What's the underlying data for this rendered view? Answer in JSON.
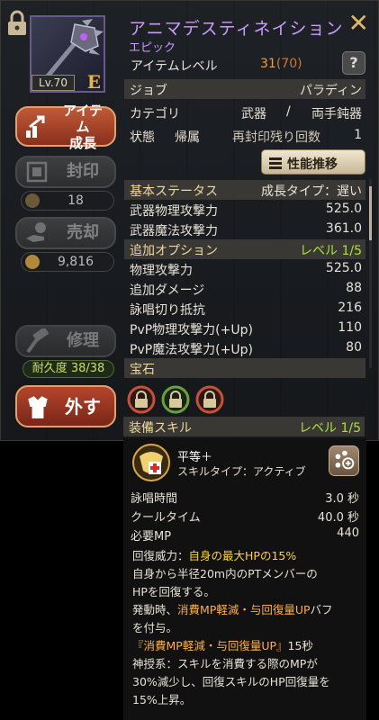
{
  "item": {
    "name": "アニマデスティネイション",
    "rarity": "エピック",
    "level_badge": "Lv.70",
    "grade": "E",
    "item_level_label": "アイテムレベル",
    "item_level": "31",
    "item_level_max": "(70)"
  },
  "buttons": {
    "grow": "アイテム\n成長",
    "seal": "封印",
    "seal_count": "18",
    "sell": "売却",
    "sell_price": "9,816",
    "repair": "修理",
    "durability": "耐久度 38/38",
    "remove": "外す",
    "recommend": "性能推移",
    "help": "?",
    "close": "✕"
  },
  "info": {
    "job_label": "ジョブ",
    "job_value": "パラディン",
    "category_label": "カテゴリ",
    "category_main": "武器",
    "category_slash": "/",
    "category_sub": "両手鈍器",
    "status_label": "状態",
    "status_value": "帰属",
    "reseal_label": "再封印残り回数",
    "reseal_value": "1"
  },
  "basic_stats": {
    "header": "基本ステータス",
    "growth_type": "成長タイプ：遅い",
    "rows": [
      {
        "name": "武器物理攻撃力",
        "value": "525.0"
      },
      {
        "name": "武器魔法攻撃力",
        "value": "361.0"
      }
    ]
  },
  "extra_options": {
    "header": "追加オプション",
    "level": "レベル 1/5",
    "rows": [
      {
        "name": "物理攻撃力",
        "value": "525.0"
      },
      {
        "name": "追加ダメージ",
        "value": "88"
      },
      {
        "name": "詠唱切り抵抗",
        "value": "216"
      },
      {
        "name": "PvP物理攻撃力(+Up)",
        "value": "110"
      },
      {
        "name": "PvP魔法攻撃力(+Up)",
        "value": "80"
      }
    ]
  },
  "gems": {
    "header": "宝石",
    "slots": [
      "red",
      "green",
      "red"
    ]
  },
  "skill": {
    "header": "装備スキル",
    "level": "レベル 1/5",
    "name": "平等＋",
    "type": "スキルタイプ：アクティブ",
    "rows": [
      {
        "name": "詠唱時間",
        "value": "3.0 秒"
      },
      {
        "name": "クールタイム",
        "value": "40.0 秒"
      },
      {
        "name": "必要MP",
        "value": "440"
      }
    ],
    "recovery_label": "回復威力：",
    "recovery_value": "自身の最大HPの15%",
    "desc1": "自身から半径20m内のPTメンバーの",
    "desc2": "HPを回復する。",
    "desc3a": "発動時、",
    "desc3b": "消費MP軽減・与回復量UP",
    "desc3c": "バフ",
    "desc4": "を付与。",
    "desc5a": "『消費MP軽減・与回復量UP』",
    "desc5b": "15秒",
    "desc6": "神授系：スキルを消費する際のMPが",
    "desc7": "30%減少し、回復スキルのHP回復量を",
    "desc8": "15%上昇。"
  },
  "colors": {
    "accent_purple": "#c89bff",
    "level_green": "#a8e040",
    "highlight_yellow": "#ffd23c",
    "button_red": "#b3452c"
  }
}
